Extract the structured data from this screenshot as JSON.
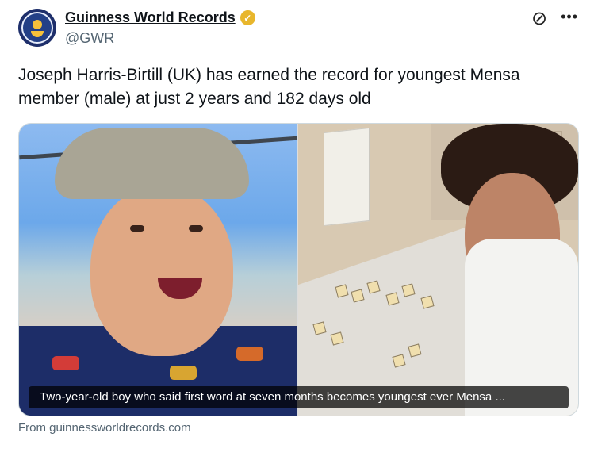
{
  "account": {
    "name": "Guinness World Records",
    "handle": "@GWR",
    "verified_symbol": "✓"
  },
  "post": {
    "text": "Joseph Harris-Birtill (UK) has earned the record for youngest Mensa member (male) at just 2 years and 182 days old",
    "media_caption": "Two-year-old boy who said first word at seven months becomes youngest ever Mensa ...",
    "source": "From guinnessworldrecords.com"
  },
  "icons": {
    "grok_icon": "⊘",
    "more_icon": "•••"
  },
  "colors": {
    "verified": "#e8b62c",
    "handle": "#536471",
    "caption_background": "rgba(0,0,0,0.72)"
  }
}
